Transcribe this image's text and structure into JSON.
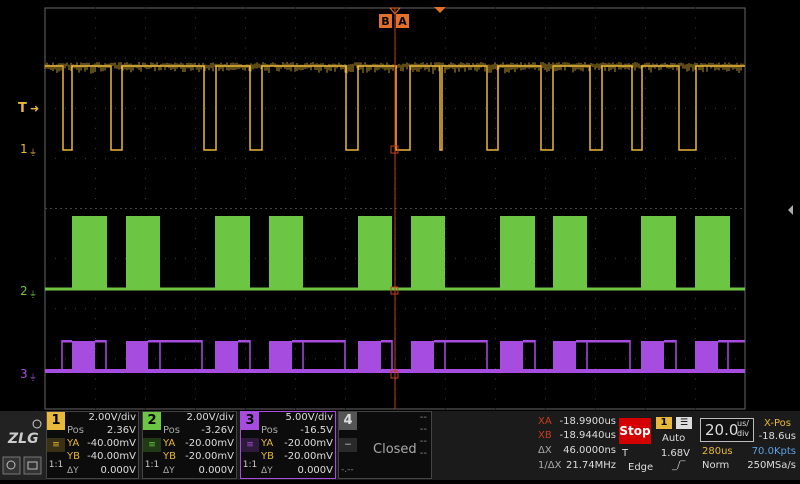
{
  "markers": {
    "b": "B",
    "a": "A",
    "trigger_level": "T"
  },
  "channels": {
    "ch1": {
      "number": "1",
      "scale": "2.00V/div",
      "pos_label": "Pos",
      "pos": "2.36V",
      "ya_label": "YA",
      "ya": "-40.00mV",
      "yb_label": "YB",
      "yb": "-40.00mV",
      "dy_label": "ΔY",
      "dy": "0.000V",
      "coupling": "1:1",
      "color": "#e8b83a"
    },
    "ch2": {
      "number": "2",
      "scale": "2.00V/div",
      "pos_label": "Pos",
      "pos": "-3.26V",
      "ya_label": "YA",
      "ya": "-20.00mV",
      "yb_label": "YB",
      "yb": "-20.00mV",
      "dy_label": "ΔY",
      "dy": "0.000V",
      "coupling": "1:1",
      "color": "#6cc644"
    },
    "ch3": {
      "number": "3",
      "scale": "5.00V/div",
      "pos_label": "Pos",
      "pos": "-16.5V",
      "ya_label": "YA",
      "ya": "-20.00mV",
      "yb_label": "YB",
      "yb": "-20.00mV",
      "dy_label": "ΔY",
      "dy": "0.000V",
      "coupling": "1:1",
      "color": "#a64de0"
    },
    "ch4": {
      "number": "4",
      "scale": "--",
      "pos": "--",
      "ya": "--",
      "yb": "--",
      "status": "Closed",
      "dash": "-.--",
      "color": "#555555"
    }
  },
  "trace_labels": {
    "ch1": "1",
    "ch2": "2",
    "ch3": "3"
  },
  "measurements": {
    "xa_label": "XA",
    "xa": "-18.9900us",
    "xb_label": "XB",
    "xb": "-18.9440us",
    "dx_label": "ΔX",
    "dx": "46.0000ns",
    "inv_dx_label": "1/ΔX",
    "inv_dx": "21.74MHz"
  },
  "run": {
    "stop_label": "Stop"
  },
  "trigger": {
    "source": "1",
    "mode": "Auto",
    "level_label": "T",
    "level": "1.68V",
    "type": "Edge"
  },
  "timebase": {
    "value": "20.0",
    "unit_top": "us/",
    "unit_bottom": "div",
    "xpos_label": "X-Pos",
    "xpos": "-18.6us",
    "window": "280us",
    "points": "70.0Kpts",
    "acq_mode": "Norm",
    "sample_rate": "250MSa/s"
  },
  "colors": {
    "ch1": "#e8b83a",
    "ch2": "#6cc644",
    "ch3": "#a64de0",
    "cursor": "#c83c1e",
    "grid": "#3a3a3a",
    "stop": "#d40000"
  },
  "icons": [
    "brand-logo-icon",
    "trigger-pointer-icon",
    "cursor-marker-icon",
    "side-menu-arrow-icon",
    "zoom-icon",
    "screenshot-icon"
  ]
}
